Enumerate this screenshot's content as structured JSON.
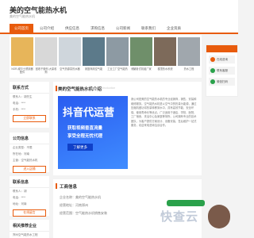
{
  "header": {
    "title": "美的空气能热水机",
    "subtitle": "美的空气能热水机"
  },
  "nav": [
    {
      "label": "公司首页",
      "active": true
    },
    {
      "label": "公司介绍",
      "active": false
    },
    {
      "label": "供应信息",
      "active": false
    },
    {
      "label": "求购信息",
      "active": false
    },
    {
      "label": "公司新闻",
      "active": false
    },
    {
      "label": "联系我们",
      "active": false
    },
    {
      "label": "企业资质",
      "active": false
    }
  ],
  "products": [
    {
      "caption": "NOR-威尔士燃烧器配件"
    },
    {
      "caption": "回收干燥剂-大量收购"
    },
    {
      "caption": "空气热源泵热水器"
    },
    {
      "caption": "家庭商用空气能"
    },
    {
      "caption": "工业工厂空气能热"
    },
    {
      "caption": "储罐卧式机组厂家"
    },
    {
      "caption": "楼顶热水系统"
    },
    {
      "caption": "热水工程"
    }
  ],
  "sidebar_contact": {
    "heading": "联系方式",
    "lines": [
      "联系人：胡先生",
      "电话：****",
      "手机：****"
    ],
    "button": "立即联系"
  },
  "sidebar_company": {
    "heading": "公司信息",
    "lines": [
      "企业类型：不限",
      "所在地：河南",
      "主营：空气能热水机"
    ],
    "button": "进入店铺"
  },
  "sidebar_contact2": {
    "heading": "联系信息",
    "lines": [
      "联系人：胡",
      "电话：****",
      "地址：河南"
    ],
    "button": "在线留言"
  },
  "sidebar_related": {
    "heading": "相关推荐企业",
    "lines": [
      "郑州空气能热水工程"
    ]
  },
  "main": {
    "heading": "美的空气能热水机介绍",
    "heading_sub": "Company Introduction",
    "ad": {
      "big": "抖音代运营",
      "line1": "获取视频垂直流量",
      "line2": "享受全程无忧代理",
      "cta": "了解更多"
    },
    "description": "我公司是美的空气能热水机的专业经销商，销售、安装和维修服务。空气能热水机是以空气中的热量为能源，通过压缩机做功将热量转移到水中，具有高效节能、安全环保、使用寿命长等优点。广泛适用于酒店、学校、医院、工厂宿舍、洗浴中心及家庭等场所。公司拥有专业的技术团队，为客户提供方案设计、设备安装、售后维护一站式服务，欢迎来电咨询洽谈合作。"
  },
  "info": {
    "heading": "工商信息",
    "rows": [
      "企业名称：美的空气能热水机",
      "经营地址：河南郑州",
      "经营范围：空气能热水机销售安装"
    ]
  },
  "float_panel": {
    "items": [
      "在线咨询",
      "联系客服",
      "微信扫码"
    ]
  },
  "watermark": "快查云"
}
